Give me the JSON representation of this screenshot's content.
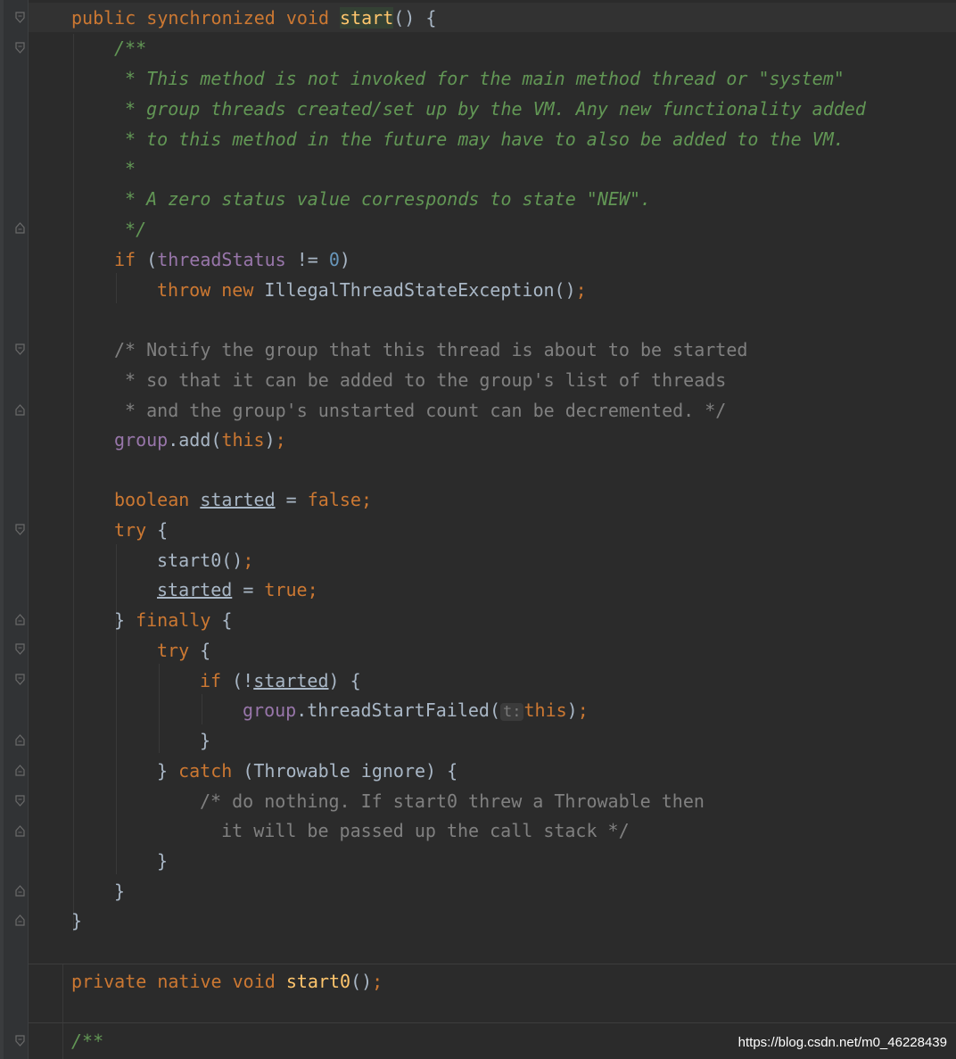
{
  "editor": {
    "lines": {
      "l1": {
        "kw": "public synchronized void ",
        "name": "start",
        "rest": "() {"
      },
      "l2": "/**",
      "l3": " * This method is not invoked for the main method thread or \"system\"",
      "l4": " * group threads created/set up by the VM. Any new functionality added",
      "l5": " * to this method in the future may have to also be added to the VM.",
      "l6": " *",
      "l7": " * A zero status value corresponds to state \"NEW\".",
      "l8": " */",
      "l9": {
        "kw": "if",
        "open": " (",
        "field": "threadStatus",
        "op": " != ",
        "num": "0",
        "close": ")"
      },
      "l10": {
        "kw": "throw new ",
        "call": "IllegalThreadStateException()",
        "semi": ";"
      },
      "l11": "/* Notify the group that this thread is about to be started",
      "l12": " * so that it can be added to the group's list of threads",
      "l13": " * and the group's unstarted count can be decremented. */",
      "l14": {
        "field": "group",
        "call": ".add(",
        "kw": "this",
        "close": ")",
        "semi": ";"
      },
      "l15": {
        "kw": "boolean ",
        "var": "started",
        "op": " = ",
        "kw2": "false",
        "semi": ";"
      },
      "l16": {
        "kw": "try",
        "rest": " {"
      },
      "l17": {
        "call": "start0()",
        "semi": ";"
      },
      "l18": {
        "var": "started",
        "op": " = ",
        "kw": "true",
        "semi": ";"
      },
      "l19": {
        "pre": "} ",
        "kw": "finally",
        "rest": " {"
      },
      "l20": {
        "kw": "try",
        "rest": " {"
      },
      "l21": {
        "kw": "if",
        "open": " (!",
        "var": "started",
        "close": ") {"
      },
      "l22": {
        "field": "group",
        "call": ".threadStartFailed(",
        "hint": "t:",
        "kw": "this",
        "close": ")",
        "semi": ";"
      },
      "l23": "}",
      "l24": {
        "pre": "} ",
        "kw": "catch",
        "rest": " (Throwable ignore) {"
      },
      "l25": "/* do nothing. If start0 threw a Throwable then",
      "l26": "  it will be passed up the call stack */",
      "l27": "}",
      "l28": "}",
      "l29": "}",
      "l30": {
        "kw": "private native void ",
        "name": "start0",
        "rest": "()",
        "semi": ";"
      },
      "l31": "/**"
    }
  },
  "watermark": "https://blog.csdn.net/m0_46228439",
  "colors": {
    "background": "#2b2b2b",
    "keyword": "#cc7832",
    "field": "#9876aa",
    "method_decl": "#ffc66d",
    "javadoc": "#629755",
    "comment": "#808080",
    "number": "#6897bb",
    "text": "#a9b7c6"
  }
}
